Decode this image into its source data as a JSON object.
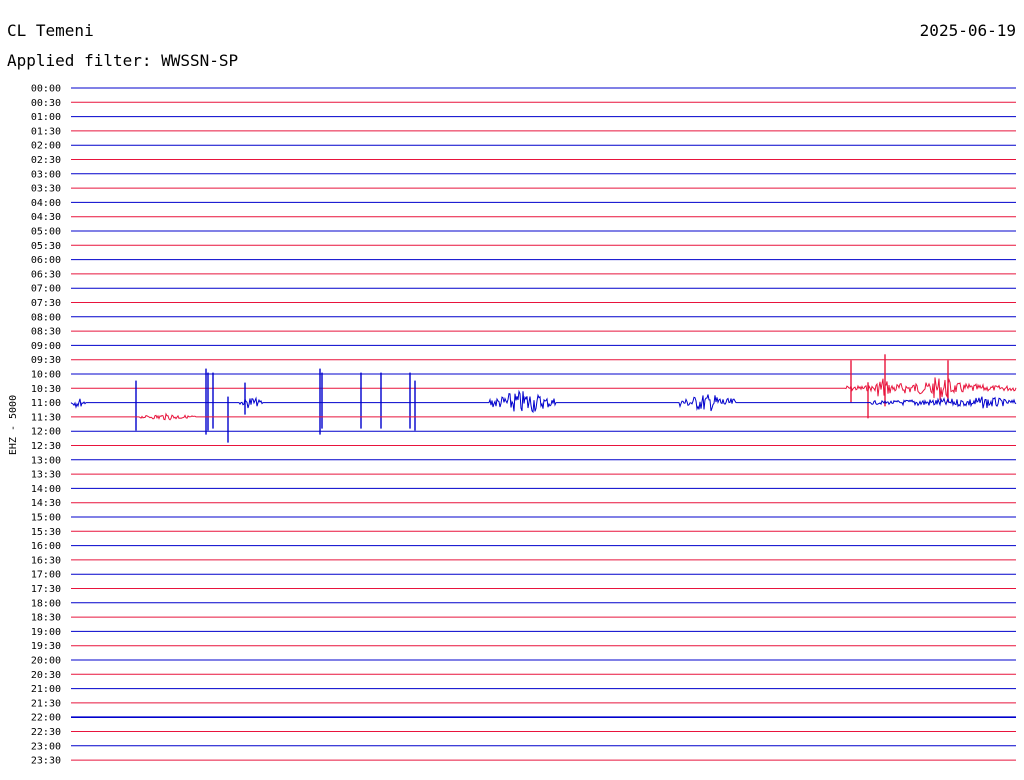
{
  "header": {
    "station": "CL Temeni",
    "date": "2025-06-19",
    "filter_label": "Applied filter: WWSSN-SP"
  },
  "channel_label": "EHZ - 5000",
  "colors": {
    "line_full_hour": "#0000cc",
    "line_half_hour": "#e8143c",
    "text": "#000000",
    "background": "#ffffff"
  },
  "time_labels": [
    "00:00",
    "00:30",
    "01:00",
    "01:30",
    "02:00",
    "02:30",
    "03:00",
    "03:30",
    "04:00",
    "04:30",
    "05:00",
    "05:30",
    "06:00",
    "06:30",
    "07:00",
    "07:30",
    "08:00",
    "08:30",
    "09:00",
    "09:30",
    "10:00",
    "10:30",
    "11:00",
    "11:30",
    "12:00",
    "12:30",
    "13:00",
    "13:30",
    "14:00",
    "14:30",
    "15:00",
    "15:30",
    "16:00",
    "16:30",
    "17:00",
    "17:30",
    "18:00",
    "18:30",
    "19:00",
    "19:30",
    "20:00",
    "20:30",
    "21:00",
    "21:30",
    "22:00",
    "22:30",
    "23:00",
    "23:30"
  ]
}
